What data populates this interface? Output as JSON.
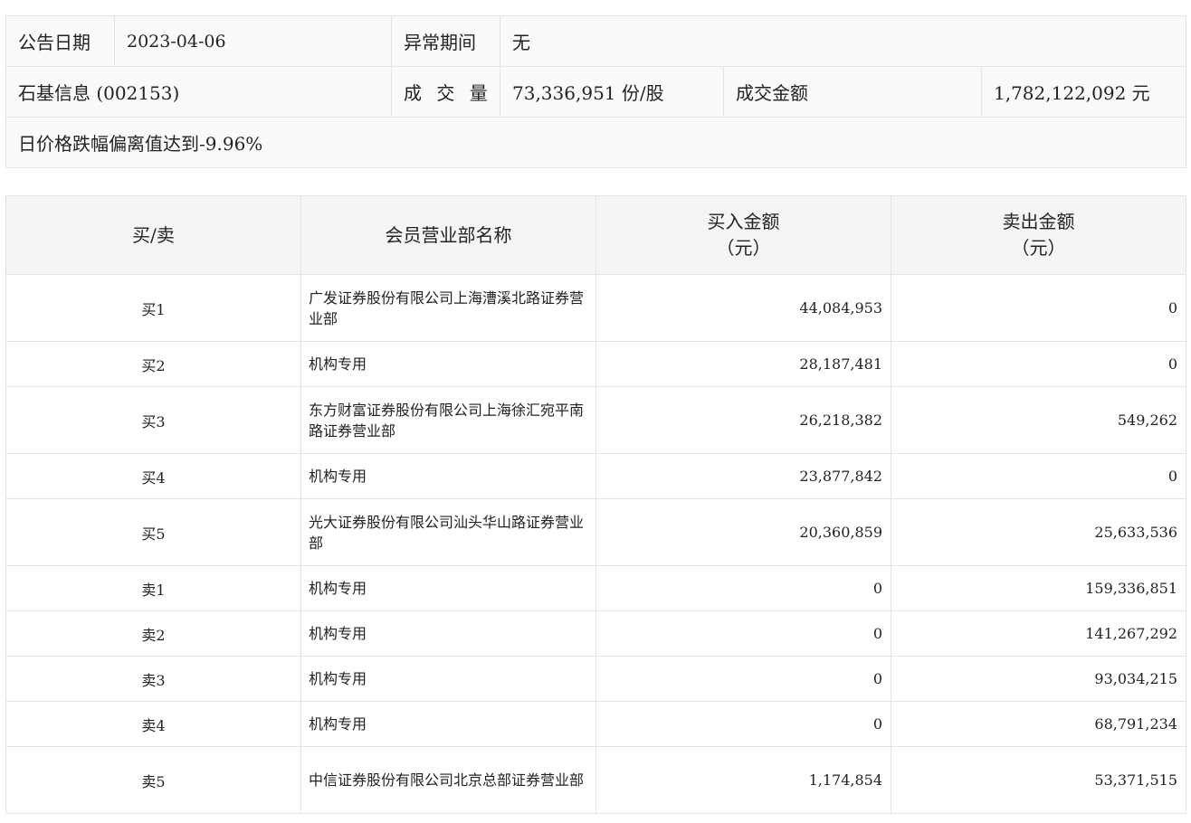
{
  "info": {
    "date_label": "公告日期",
    "date_value": "2023-04-06",
    "period_label": "异常期间",
    "period_value": "无",
    "stock": "石基信息 (002153)",
    "volume_label": "成 交 量",
    "volume_value": "73,336,951 份/股",
    "amount_label": "成交金额",
    "amount_value": "1,782,122,092 元",
    "reason": "日价格跌幅偏离值达到-9.96%"
  },
  "trade_table": {
    "headers": {
      "side": "买/卖",
      "branch": "会员营业部名称",
      "buy_line1": "买入金额",
      "buy_line2": "（元）",
      "sell_line1": "卖出金额",
      "sell_line2": "（元）"
    },
    "rows": [
      {
        "side": "买1",
        "name": "广发证券股份有限公司上海漕溪北路证券营业部",
        "buy": "44,084,953",
        "sell": "0"
      },
      {
        "side": "买2",
        "name": "机构专用",
        "buy": "28,187,481",
        "sell": "0"
      },
      {
        "side": "买3",
        "name": "东方财富证券股份有限公司上海徐汇宛平南路证券营业部",
        "buy": "26,218,382",
        "sell": "549,262"
      },
      {
        "side": "买4",
        "name": "机构专用",
        "buy": "23,877,842",
        "sell": "0"
      },
      {
        "side": "买5",
        "name": "光大证券股份有限公司汕头华山路证券营业部",
        "buy": "20,360,859",
        "sell": "25,633,536"
      },
      {
        "side": "卖1",
        "name": "机构专用",
        "buy": "0",
        "sell": "159,336,851"
      },
      {
        "side": "卖2",
        "name": "机构专用",
        "buy": "0",
        "sell": "141,267,292"
      },
      {
        "side": "卖3",
        "name": "机构专用",
        "buy": "0",
        "sell": "93,034,215"
      },
      {
        "side": "卖4",
        "name": "机构专用",
        "buy": "0",
        "sell": "68,791,234"
      },
      {
        "side": "卖5",
        "name": "中信证券股份有限公司北京总部证券营业部",
        "buy": "1,174,854",
        "sell": "53,371,515"
      }
    ]
  }
}
